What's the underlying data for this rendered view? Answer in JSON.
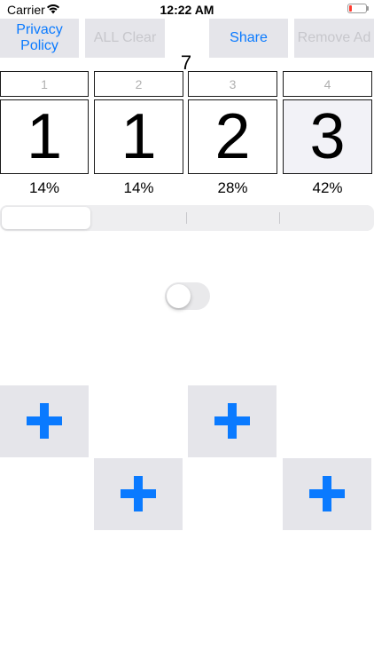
{
  "status_bar": {
    "carrier": "Carrier",
    "time": "12:22 AM",
    "battery_color": "#ff3b30"
  },
  "toolbar": {
    "privacy_label": "Privacy Policy",
    "clear_label": "ALL Clear",
    "share_label": "Share",
    "remove_ad_label": "Remove Ad"
  },
  "total_count": "7",
  "columns": [
    {
      "label": "1",
      "count": "1",
      "percent": "14%"
    },
    {
      "label": "2",
      "count": "1",
      "percent": "14%"
    },
    {
      "label": "3",
      "count": "2",
      "percent": "28%"
    },
    {
      "label": "4",
      "count": "3",
      "percent": "42%"
    }
  ],
  "segmented": {
    "segments": 4,
    "selected_index": 0
  },
  "toggle": {
    "on": false
  },
  "plus_buttons": [
    "plus-icon",
    "plus-icon",
    "plus-icon",
    "plus-icon"
  ],
  "colors": {
    "accent": "#0a7aff",
    "disabled_text": "#c7c7cc",
    "button_bg": "#e5e5ea"
  }
}
